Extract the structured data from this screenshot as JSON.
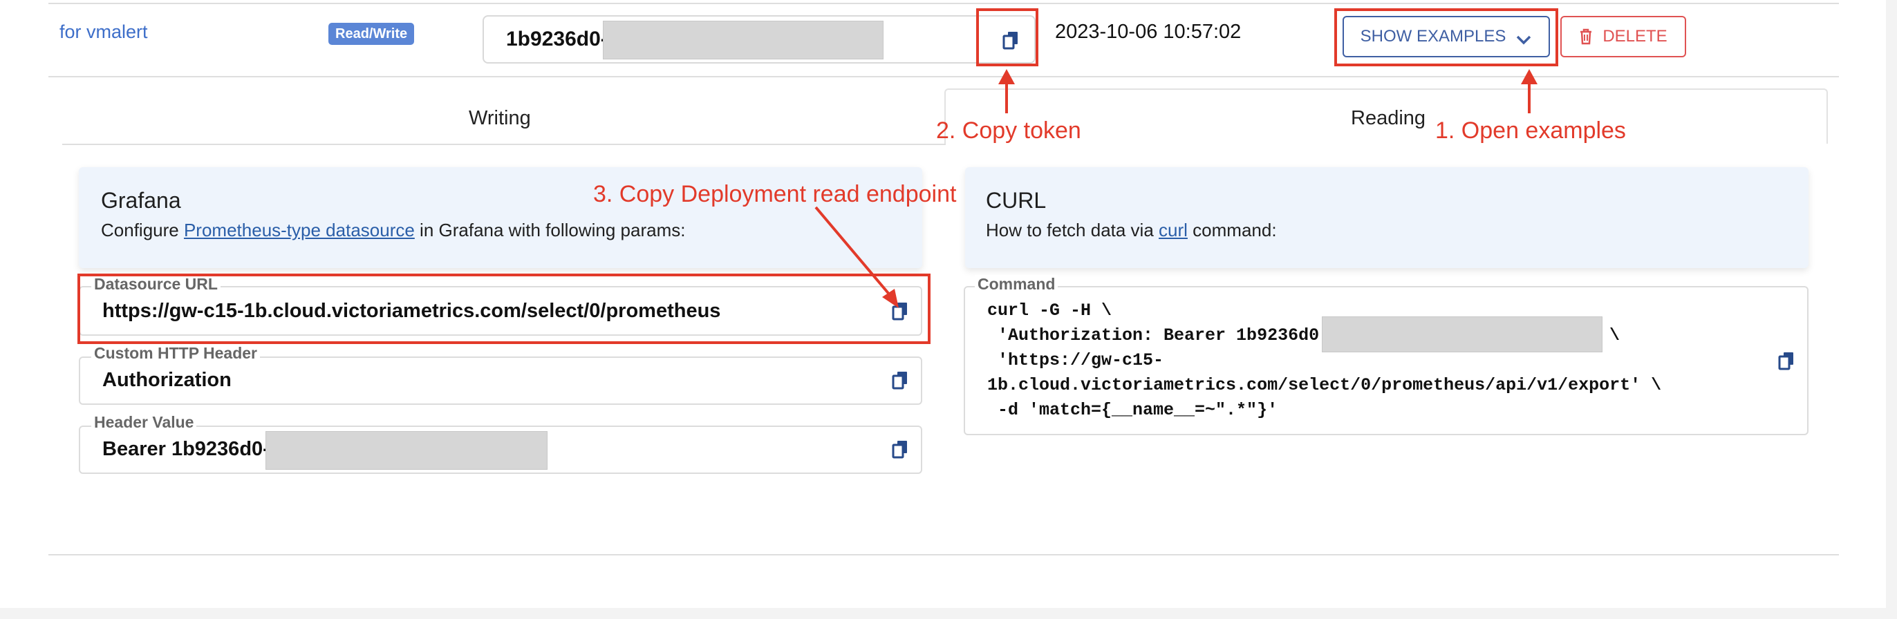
{
  "token_row": {
    "name": "for vmalert",
    "access_badge": "Read/Write",
    "token_visible": "1b9236d0-",
    "created_at": "2023-10-06 10:57:02",
    "show_examples_label": "SHOW EXAMPLES",
    "delete_label": "DELETE"
  },
  "tabs": [
    {
      "label": "Writing"
    },
    {
      "label": "Reading"
    }
  ],
  "grafana": {
    "title": "Grafana",
    "desc_prefix": "Configure ",
    "desc_link": "Prometheus-type datasource",
    "desc_suffix": " in Grafana with following params:",
    "fields": [
      {
        "label": "Datasource URL",
        "value": "https://gw-c15-1b.cloud.victoriametrics.com/select/0/prometheus"
      },
      {
        "label": "Custom HTTP Header",
        "value": "Authorization"
      },
      {
        "label": "Header Value",
        "value": "Bearer 1b9236d0-4"
      }
    ]
  },
  "curl": {
    "title": "CURL",
    "desc_prefix": "How to fetch data via ",
    "desc_link": "curl",
    "desc_suffix": " command:",
    "command_label": "Command",
    "lines": [
      "curl -G -H \\",
      " 'Authorization: Bearer 1b9236d0-",
      " 'https://gw-c15-",
      "1b.cloud.victoriametrics.com/select/0/prometheus/api/v1/export' \\",
      " -d 'match={__name__=~\".*\"}'"
    ],
    "line2_tail": "\\"
  },
  "annotations": {
    "open_examples": "1. Open examples",
    "copy_token": "2. Copy token",
    "copy_endpoint": "3. Copy Deployment read endpoint"
  },
  "colors": {
    "annotation_red": "#e23a2a",
    "primary_blue": "#3f5fa3",
    "delete_red": "#e05252",
    "badge_blue": "#5b86d6",
    "card_bg": "#eef4fc"
  },
  "icons": [
    "copy-icon",
    "chevron-down-icon",
    "trash-icon"
  ]
}
